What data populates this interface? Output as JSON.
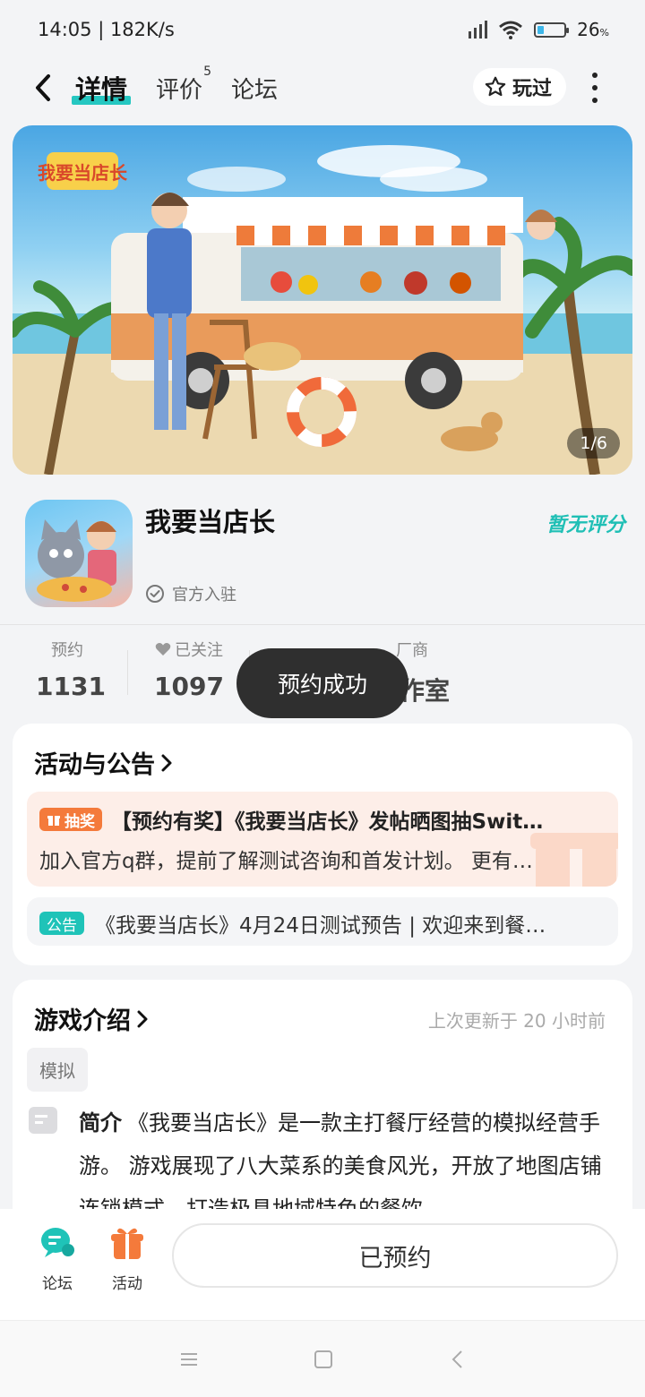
{
  "status_bar": {
    "time_speed": "14:05 | 182K/s",
    "battery": "26",
    "battery_unit": "%",
    "battery_level": 0.26
  },
  "nav": {
    "tabs": [
      {
        "label": "详情",
        "active": true
      },
      {
        "label": "评价",
        "badge": "5"
      },
      {
        "label": "论坛"
      }
    ],
    "played_label": "玩过"
  },
  "banner": {
    "counter": "1/6"
  },
  "app": {
    "name": "我要当店长",
    "official_label": "官方入驻",
    "rating_label": "暂无评分"
  },
  "stats": [
    {
      "label": "预约",
      "value": "1131"
    },
    {
      "label": "已关注",
      "value": "1097"
    },
    {
      "label": "厂商",
      "value": "工作室"
    }
  ],
  "toast": "预约成功",
  "activities": {
    "title": "活动与公告",
    "items": [
      {
        "tag": "抽奖",
        "title": "【预约有奖】《我要当店长》发帖晒图抽Swit…",
        "desc": "加入官方q群，提前了解测试咨询和首发计划。 更有…"
      },
      {
        "tag": "公告",
        "title": "《我要当店长》4月24日测试预告 | 欢迎来到餐…"
      }
    ]
  },
  "intro": {
    "title": "游戏介绍",
    "updated": "上次更新于 20 小时前",
    "genre": "模拟",
    "label": "简介",
    "text": "《我要当店长》是一款主打餐厅经营的模拟经营手游。 游戏展现了八大菜系的美食风光，开放了地图店铺连锁模式，打造极具地域特色的餐饮"
  },
  "bottom": {
    "forum_label": "论坛",
    "activity_label": "活动",
    "reserved_label": "已预约"
  },
  "colors": {
    "accent": "#25c7c1",
    "orange": "#f47a3b",
    "toast_bg": "#2f2f2f"
  }
}
